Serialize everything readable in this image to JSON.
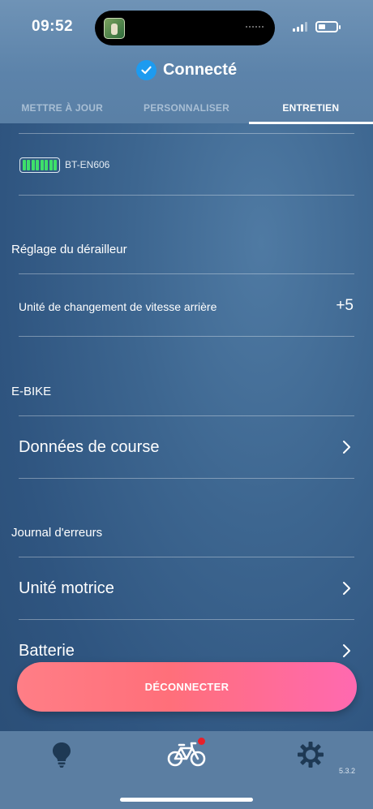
{
  "status_bar": {
    "time": "09:52"
  },
  "header": {
    "status_label": "Connecté"
  },
  "tabs": [
    {
      "label": "METTRE À JOUR",
      "active": false
    },
    {
      "label": "PERSONNALISER",
      "active": false
    },
    {
      "label": "ENTRETIEN",
      "active": true
    }
  ],
  "device": {
    "name": "BT-EN606",
    "battery_segments_lit": 8,
    "battery_color": "#3ee06a"
  },
  "sections": {
    "derailleur": {
      "heading": "Réglage du dérailleur",
      "rear_shift_unit_label": "Unité de changement de vitesse arrière",
      "rear_shift_unit_value": "+5"
    },
    "ebike": {
      "heading": "E-BIKE",
      "ride_data_label": "Données de course"
    },
    "error_log": {
      "heading": "Journal d'erreurs",
      "drive_unit_label": "Unité motrice",
      "battery_label": "Batterie"
    }
  },
  "actions": {
    "disconnect_label": "DÉCONNECTER"
  },
  "bottom_nav": {
    "items": [
      {
        "icon": "lightbulb-icon"
      },
      {
        "icon": "bicycle-icon",
        "badge": true
      },
      {
        "icon": "gear-icon"
      }
    ],
    "version": "5.3.2"
  },
  "colors": {
    "accent_check": "#1d9bf0",
    "disconnect_gradient_start": "#ff7e86",
    "disconnect_gradient_end": "#ff69b0",
    "badge": "#e8202a"
  }
}
